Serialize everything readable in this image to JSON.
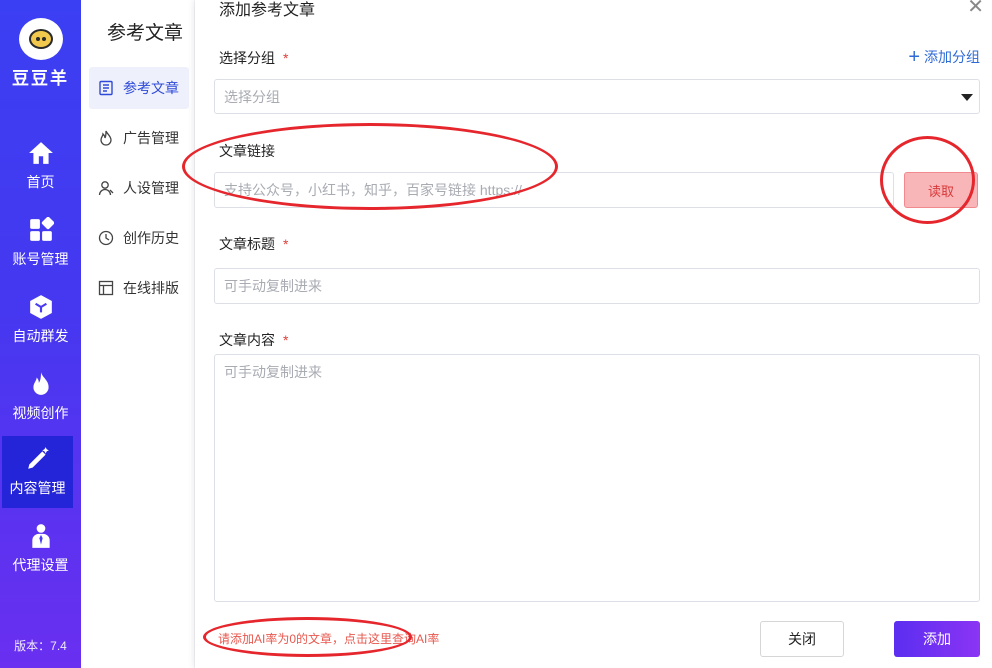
{
  "app": {
    "brand": "豆豆羊",
    "version": "版本：7.4"
  },
  "rail": {
    "items": [
      {
        "label": "首页"
      },
      {
        "label": "账号管理"
      },
      {
        "label": "自动群发"
      },
      {
        "label": "视频创作"
      },
      {
        "label": "内容管理"
      },
      {
        "label": "代理设置"
      }
    ],
    "active_index": 4
  },
  "submenu": {
    "title": "参考文章",
    "items": [
      {
        "label": "参考文章"
      },
      {
        "label": "广告管理"
      },
      {
        "label": "人设管理"
      },
      {
        "label": "创作历史"
      },
      {
        "label": "在线排版"
      }
    ],
    "active_index": 0
  },
  "dialog": {
    "title": "添加参考文章",
    "close_icon": "close-icon",
    "group": {
      "label": "选择分组",
      "required": "*",
      "placeholder": "选择分组",
      "add_label": "添加分组"
    },
    "link": {
      "label": "文章链接",
      "placeholder": "支持公众号，小红书，知乎，百家号链接 https://",
      "read_label": "读取"
    },
    "title_field": {
      "label": "文章标题",
      "required": "*",
      "placeholder": "可手动复制进来"
    },
    "content_field": {
      "label": "文章内容",
      "required": "*",
      "placeholder": "可手动复制进来"
    },
    "hint": "请添加AI率为0的文章，点击这里查询AI率",
    "close_label": "关闭",
    "add_label": "添加"
  },
  "colors": {
    "rail_top": "#3b3ff3",
    "rail_bottom": "#6a2ff0",
    "accent_blue": "#2f6bd6",
    "danger": "#e5262c",
    "add_button": "#6f31f2"
  }
}
